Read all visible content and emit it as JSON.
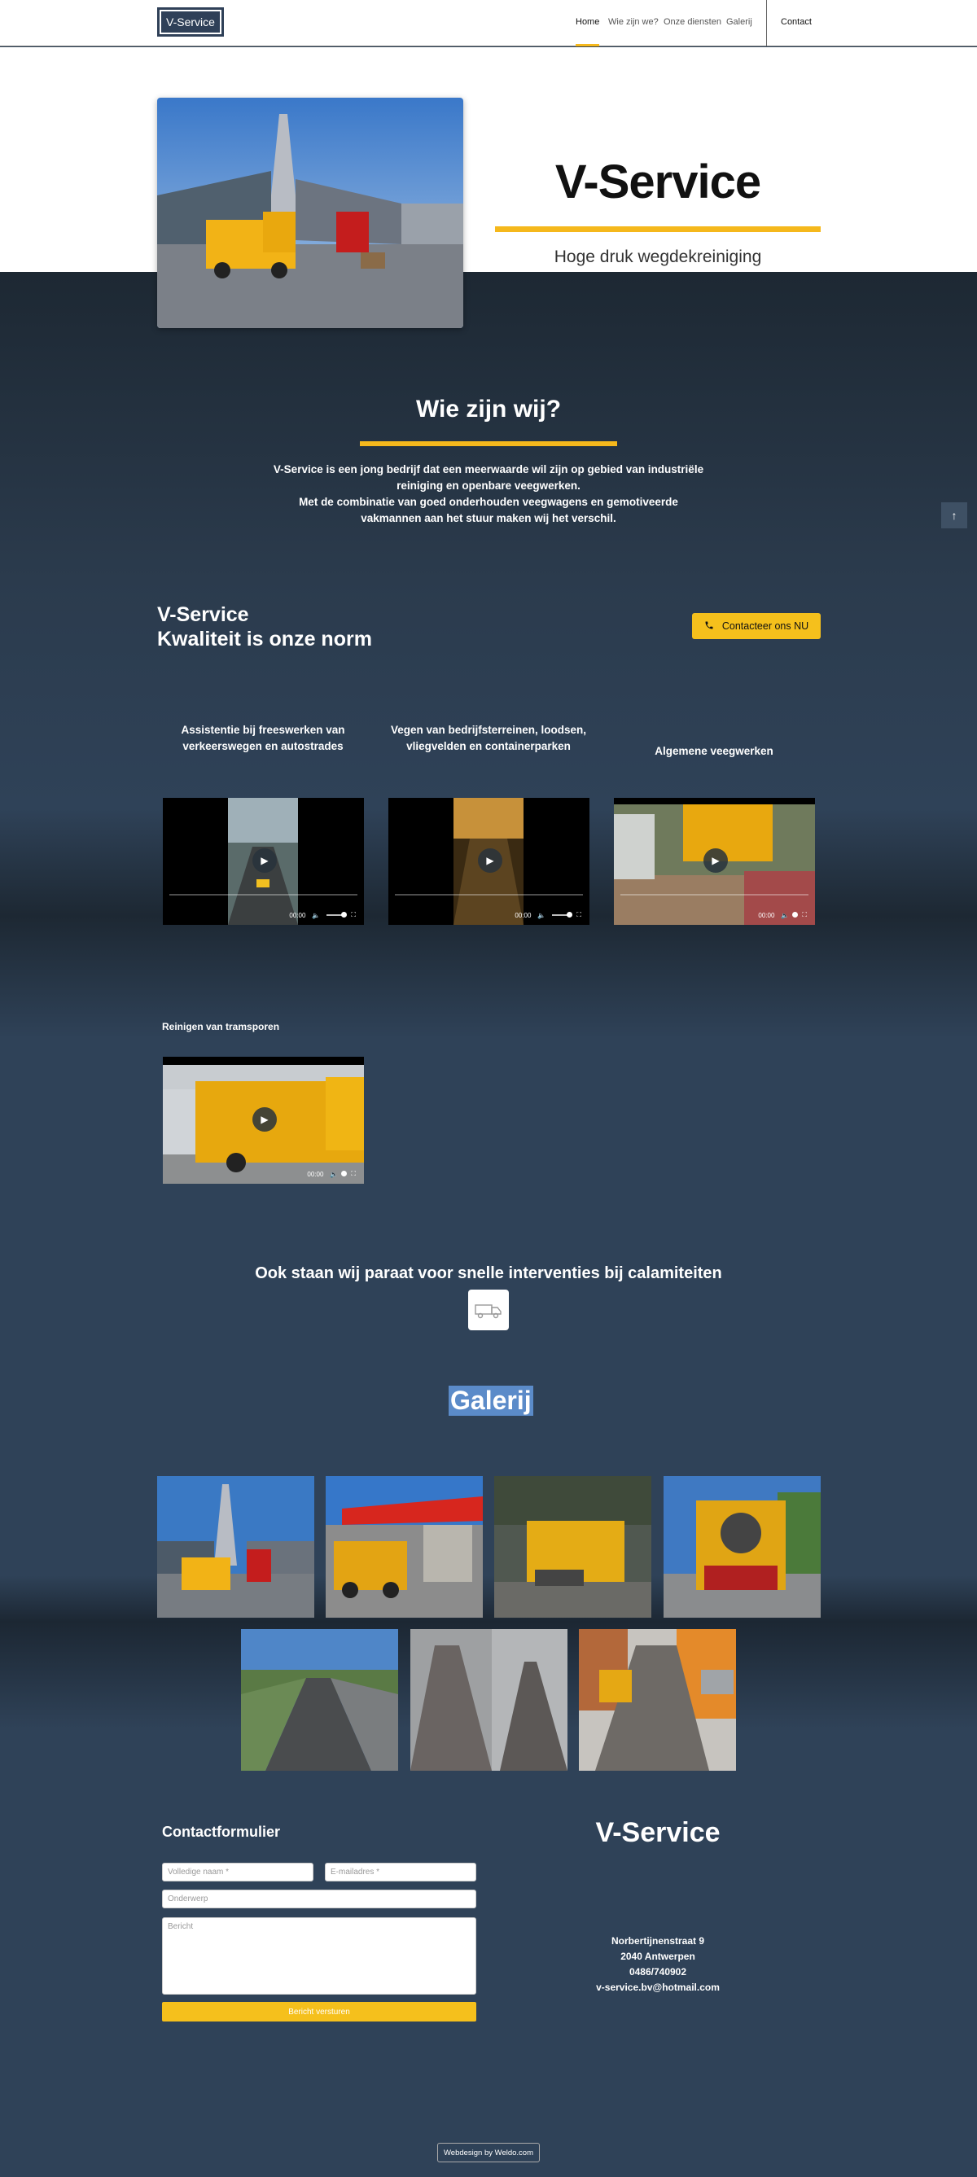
{
  "header": {
    "logo": "V-Service",
    "nav": [
      "Home",
      "Wie zijn we?",
      "Onze diensten",
      "Galerij"
    ],
    "contact": "Contact"
  },
  "hero": {
    "title": "V-Service",
    "subtitle": "Hoge druk wegdekreiniging"
  },
  "about": {
    "title": "Wie zijn wij?",
    "line1": "V-Service is een jong bedrijf dat een meerwaarde wil zijn op gebied van industriële reiniging en openbare veegwerken.",
    "line2": "Met de combinatie van goed onderhouden veegwagens en gemotiveerde vakmannen aan het stuur maken wij het verschil."
  },
  "quality": {
    "line1": "V-Service",
    "line2": "Kwaliteit is onze norm",
    "cta": "Contacteer ons NU"
  },
  "services": [
    {
      "label": "Assistentie bij freeswerken van verkeerswegen en autostrades",
      "time": "00:00"
    },
    {
      "label": "Vegen van bedrijfsterreinen, loodsen, vliegvelden en containerparken",
      "time": "00:00"
    },
    {
      "label": "Algemene veegwerken",
      "time": "00:00"
    },
    {
      "label": "Reinigen van tramsporen",
      "time": "00:00"
    }
  ],
  "emergency": {
    "title": "Ook staan wij paraat voor snelle interventies bij calamiteiten",
    "icon": "truck-icon"
  },
  "gallery": {
    "title": "Galerij"
  },
  "contact_form": {
    "title": "Contactformulier",
    "name_placeholder": "Volledige naam *",
    "email_placeholder": "E-mailadres *",
    "subject_placeholder": "Onderwerp",
    "message_placeholder": "Bericht",
    "submit": "Bericht versturen"
  },
  "footer": {
    "brand": "V-Service",
    "street": "Norbertijnenstraat 9",
    "city": "2040 Antwerpen",
    "phone": "0486/740902",
    "email": "v-service.bv@hotmail.com",
    "credit": "Webdesign by Weldo.com"
  },
  "colors": {
    "accent": "#f5b81c",
    "dark": "#1d2833",
    "navy": "#2f4258"
  }
}
